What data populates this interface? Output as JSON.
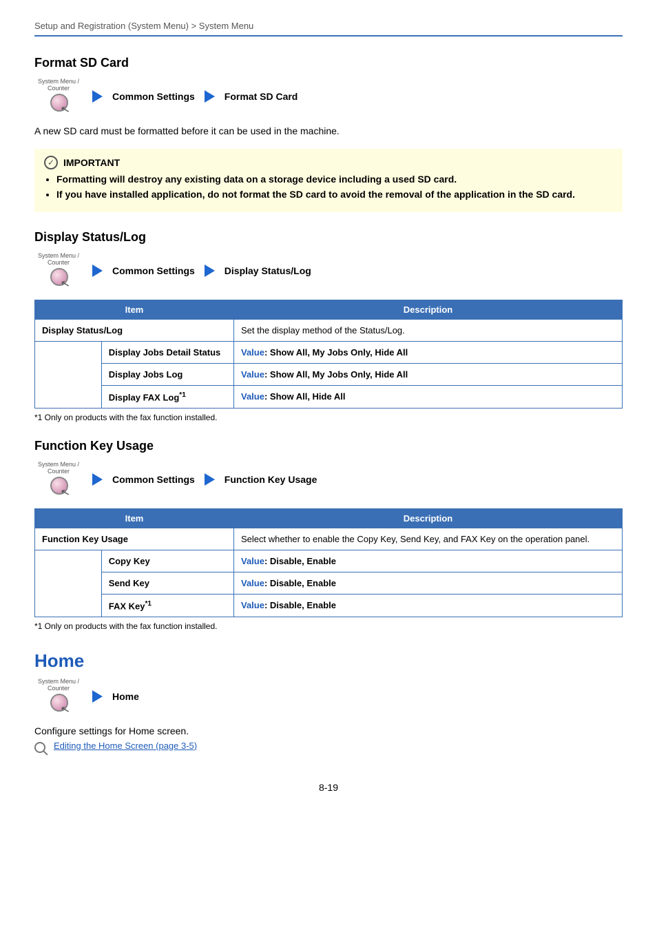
{
  "runningHead": "Setup and Registration (System Menu) > System Menu",
  "sysMenuLabel": "System Menu / Counter",
  "pageNumber": "8-19",
  "sec1": {
    "title": "Format SD Card",
    "navCommon": "Common Settings",
    "navLeaf": "Format SD Card",
    "intro": "A new SD card must be formatted before it can be used in the machine.",
    "importantLabel": "IMPORTANT",
    "bullets": [
      "Formatting will destroy any existing data on a storage device including a used SD card.",
      "If you have installed application, do not format the SD card to avoid the removal of the application in the SD card."
    ]
  },
  "sec2": {
    "title": "Display Status/Log",
    "navCommon": "Common Settings",
    "navLeaf": "Display Status/Log",
    "thItem": "Item",
    "thDesc": "Description",
    "row0Item": "Display Status/Log",
    "row0Desc": "Set the display method of the Status/Log.",
    "subs": [
      {
        "label": "Display Jobs Detail Status",
        "valuePrefix": "Value",
        "valueRest": ": Show All, My Jobs Only, Hide All"
      },
      {
        "label": "Display Jobs Log",
        "valuePrefix": "Value",
        "valueRest": ": Show All, My Jobs Only, Hide All"
      },
      {
        "labelHtmlBase": "Display FAX Log",
        "labelSup": "*1",
        "valuePrefix": "Value",
        "valueRest": ": Show All, Hide All"
      }
    ],
    "footnote": "*1   Only on products with the fax function installed."
  },
  "sec3": {
    "title": "Function Key Usage",
    "navCommon": "Common Settings",
    "navLeaf": "Function Key Usage",
    "thItem": "Item",
    "thDesc": "Description",
    "row0Item": "Function Key Usage",
    "row0Desc": "Select whether to enable the Copy Key, Send Key, and FAX Key on the operation panel.",
    "subs": [
      {
        "label": "Copy Key",
        "valuePrefix": "Value",
        "valueRest": ": Disable, Enable"
      },
      {
        "label": "Send Key",
        "valuePrefix": "Value",
        "valueRest": ": Disable, Enable"
      },
      {
        "labelHtmlBase": "FAX Key",
        "labelSup": "*1",
        "valuePrefix": "Value",
        "valueRest": ": Disable, Enable"
      }
    ],
    "footnote": "*1   Only on products with the fax function installed."
  },
  "sec4": {
    "title": "Home",
    "navLeaf": "Home",
    "body": "Configure settings for Home screen.",
    "refLink": "Editing the Home Screen (page 3-5)"
  }
}
